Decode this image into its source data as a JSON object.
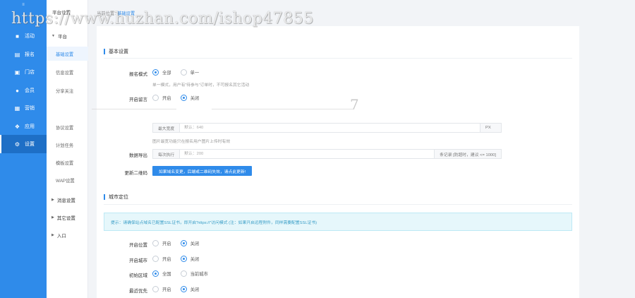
{
  "watermark": "https://www.huzhan.com/ishop47855",
  "watermark_extra": "7",
  "rail": {
    "logo": "≡",
    "items": [
      {
        "label": "活动",
        "icon": "■"
      },
      {
        "label": "报名",
        "icon": "▤"
      },
      {
        "label": "门店",
        "icon": "▣"
      },
      {
        "label": "会员",
        "icon": "●"
      },
      {
        "label": "营销",
        "icon": "▦"
      },
      {
        "label": "应用",
        "icon": "❖"
      },
      {
        "label": "设置",
        "icon": "⚙"
      }
    ]
  },
  "submenu": {
    "title": "平台设置",
    "group_platform": "平台",
    "items": [
      "基础设置",
      "信息设置",
      "分享关注",
      "",
      "协议设置",
      "计划任务",
      "模板设置",
      "WAP设置"
    ],
    "groups": [
      "消息设置",
      "其它设置",
      "入口"
    ]
  },
  "breadcrumb": {
    "prefix": "当前位置:",
    "current": "基础设置"
  },
  "basic": {
    "title": "基本设置",
    "signup_mode": {
      "label": "报名模式",
      "options": [
        "全部",
        "单一"
      ],
      "help": "单一模式，用户有“待参与”订单时，不可报名其它活动"
    },
    "comment": {
      "label": "开启留言",
      "options": [
        "开启",
        "关闭"
      ]
    },
    "max_width": {
      "addon": "最大宽度",
      "placeholder": "默认：640",
      "unit": "PX",
      "help": "图片最宽功能只在报名用户图片上传时有效"
    },
    "export": {
      "label": "数据导出",
      "addon": "每次执行",
      "placeholder": "默认：200",
      "unit": "条记录 [防超时，建议 <= 1000]"
    },
    "qrcode": {
      "label": "更新二维码",
      "button": "如果域名变更，后端或二维码失效，请点此更新!"
    }
  },
  "city": {
    "title": "城市定位",
    "notice": "提示：请确保站点域名已配置SSL证书，即开启“https://”访问模式 (注：如果开启远程附件，同样需要配置SSL证书)",
    "rows": [
      {
        "label": "开启位置",
        "options": [
          "开启",
          "关闭"
        ]
      },
      {
        "label": "开启城市",
        "options": [
          "开启",
          "关闭"
        ]
      },
      {
        "label": "初始区域",
        "options": [
          "全国",
          "当前城市"
        ]
      },
      {
        "label": "最近优先",
        "options": [
          "开启",
          "关闭"
        ]
      }
    ]
  }
}
